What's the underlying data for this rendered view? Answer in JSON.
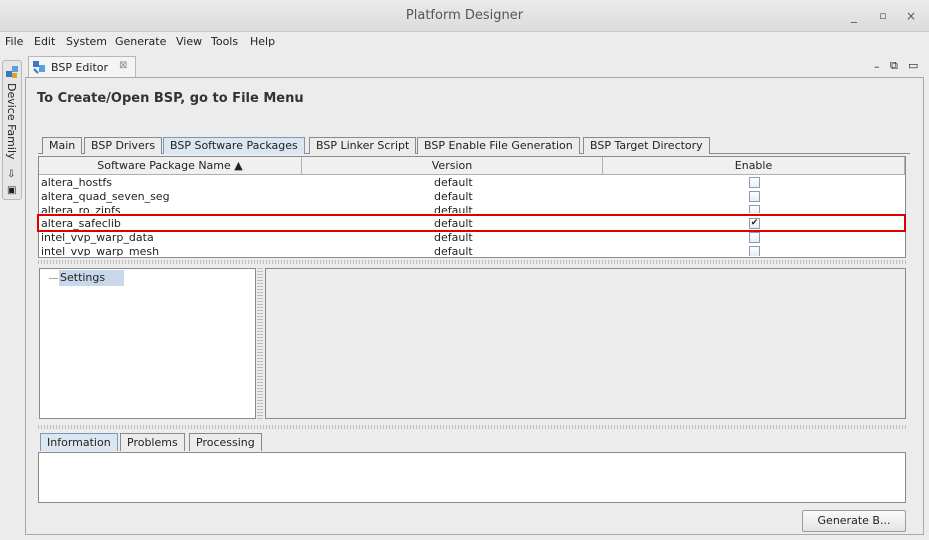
{
  "window": {
    "title": "Platform Designer"
  },
  "menu": [
    "File",
    "Edit",
    "System",
    "Generate",
    "View",
    "Tools",
    "Help"
  ],
  "sidebar": {
    "label": "Device Family"
  },
  "editor_tab": {
    "label": "BSP Editor",
    "close": "⊠"
  },
  "header": "To Create/Open BSP, go to File Menu",
  "tabs": [
    "Main",
    "BSP Drivers",
    "BSP Software Packages",
    "BSP Linker Script",
    "BSP Enable File Generation",
    "BSP Target Directory"
  ],
  "table": {
    "columns": [
      "Software Package Name ▲",
      "Version",
      "Enable"
    ],
    "rows": [
      {
        "name": "altera_hostfs",
        "version": "default",
        "enabled": false
      },
      {
        "name": "altera_quad_seven_seg",
        "version": "default",
        "enabled": false
      },
      {
        "name": "altera_ro_zipfs",
        "version": "default",
        "enabled": false
      },
      {
        "name": "altera_safeclib",
        "version": "default",
        "enabled": true
      },
      {
        "name": "intel_vvp_warp_data",
        "version": "default",
        "enabled": false
      },
      {
        "name": "intel_vvp_warp_mesh",
        "version": "default",
        "enabled": false
      }
    ]
  },
  "tree": {
    "settings": "Settings"
  },
  "bottom_tabs": [
    "Information",
    "Problems",
    "Processing"
  ],
  "generate_button": "Generate B...",
  "colors": {
    "highlight": "#e00000",
    "active_tab": "#dce6f0",
    "selection": "#c8d8ea"
  }
}
